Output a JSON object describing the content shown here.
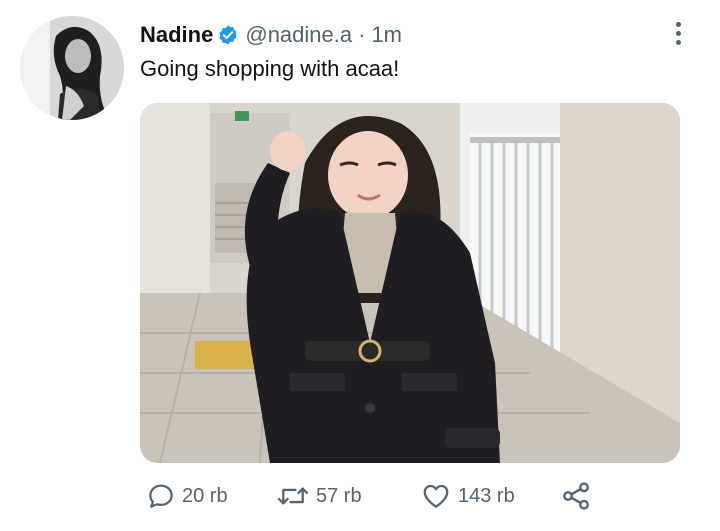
{
  "tweet": {
    "display_name": "Nadine",
    "handle": "@nadine.a",
    "separator": "·",
    "time": "1m",
    "text": "Going shopping with acaa!"
  },
  "actions": {
    "reply_count": "20 rb",
    "retweet_count": "57 rb",
    "like_count": "143 rb"
  },
  "icons": {
    "verified": "verified-badge-icon",
    "more": "more-vertical-icon",
    "reply": "reply-icon",
    "retweet": "retweet-icon",
    "like": "heart-icon",
    "share": "share-icon"
  },
  "colors": {
    "verified_blue": "#1d9bf0",
    "text_primary": "#0f1419",
    "text_secondary": "#536471"
  }
}
